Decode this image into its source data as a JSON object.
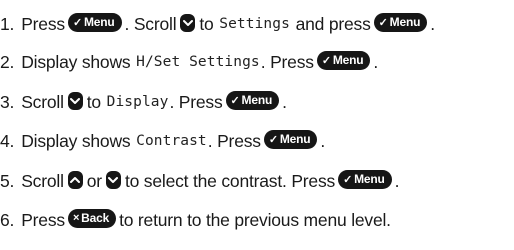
{
  "buttons": {
    "menu": "Menu",
    "back": "Back",
    "check": "✓",
    "cross": "×"
  },
  "steps": [
    {
      "num": "1.",
      "press": "Press",
      "t1": ". Scroll",
      "t2": "to",
      "display": "Settings",
      "t3": "and press",
      "end": "."
    },
    {
      "num": "2.",
      "t1": "Display shows",
      "display": "H/Set Settings",
      "t2": ". Press",
      "end": "."
    },
    {
      "num": "3.",
      "t1": "Scroll",
      "t2": "to",
      "display": "Display",
      "t3": ". Press",
      "end": "."
    },
    {
      "num": "4.",
      "t1": "Display shows",
      "display": "Contrast",
      "t2": ". Press",
      "end": "."
    },
    {
      "num": "5.",
      "t1": "Scroll",
      "t2": "or",
      "t3": "to select the contrast. Press",
      "end": "."
    },
    {
      "num": "6.",
      "t1": "Press",
      "t2": "to return to the previous menu level."
    }
  ]
}
